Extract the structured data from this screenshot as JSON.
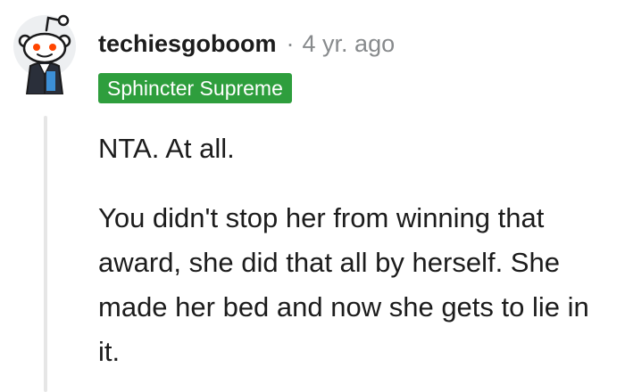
{
  "comment": {
    "author": "techiesgoboom",
    "separator": "·",
    "timestamp": "4 yr. ago",
    "flair": "Sphincter Supreme",
    "paragraphs": [
      "NTA. At all.",
      "You didn't stop her from winning that award, she did that all by herself. She made her bed and now she gets to lie in it."
    ]
  },
  "colors": {
    "flair_background": "#2e9e3d",
    "text": "#1c1c1c",
    "muted": "#878a8c",
    "thread_line": "#e6e6e6"
  },
  "icons": {
    "avatar": "snoo-avatar-icon"
  }
}
